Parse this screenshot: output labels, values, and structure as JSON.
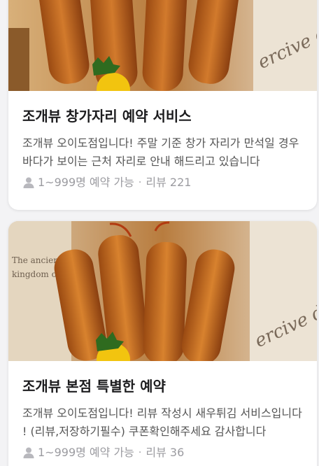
{
  "cards": [
    {
      "title": "조개뷰 창가자리 예약 서비스",
      "description": "조개뷰 오이도점입니다! 주말 기준 창가 자리가 만석일 경우 바다가 보이는 근처 자리로 안내 해드리고 있습니다",
      "capacity": "1~999명 예약 가능",
      "separator": "·",
      "reviews": "리뷰 221",
      "image_alt": "fried shrimp photo"
    },
    {
      "title": "조개뷰 본점 특별한 예약",
      "description": "조개뷰 오이도점입니다! 리뷰 작성시 새우튀김 서비스입니다 ! (리뷰,저장하기필수) 쿠폰확인해주세요 감사합니다",
      "capacity": "1~999명 예약 가능",
      "separator": "·",
      "reviews": "리뷰 36",
      "image_alt": "fried shrimp photo"
    }
  ],
  "colors": {
    "card_bg": "#ffffff",
    "page_bg": "#f3f3f5",
    "title": "#1c1c1e",
    "desc": "#555555",
    "meta": "#9b9ba0"
  }
}
